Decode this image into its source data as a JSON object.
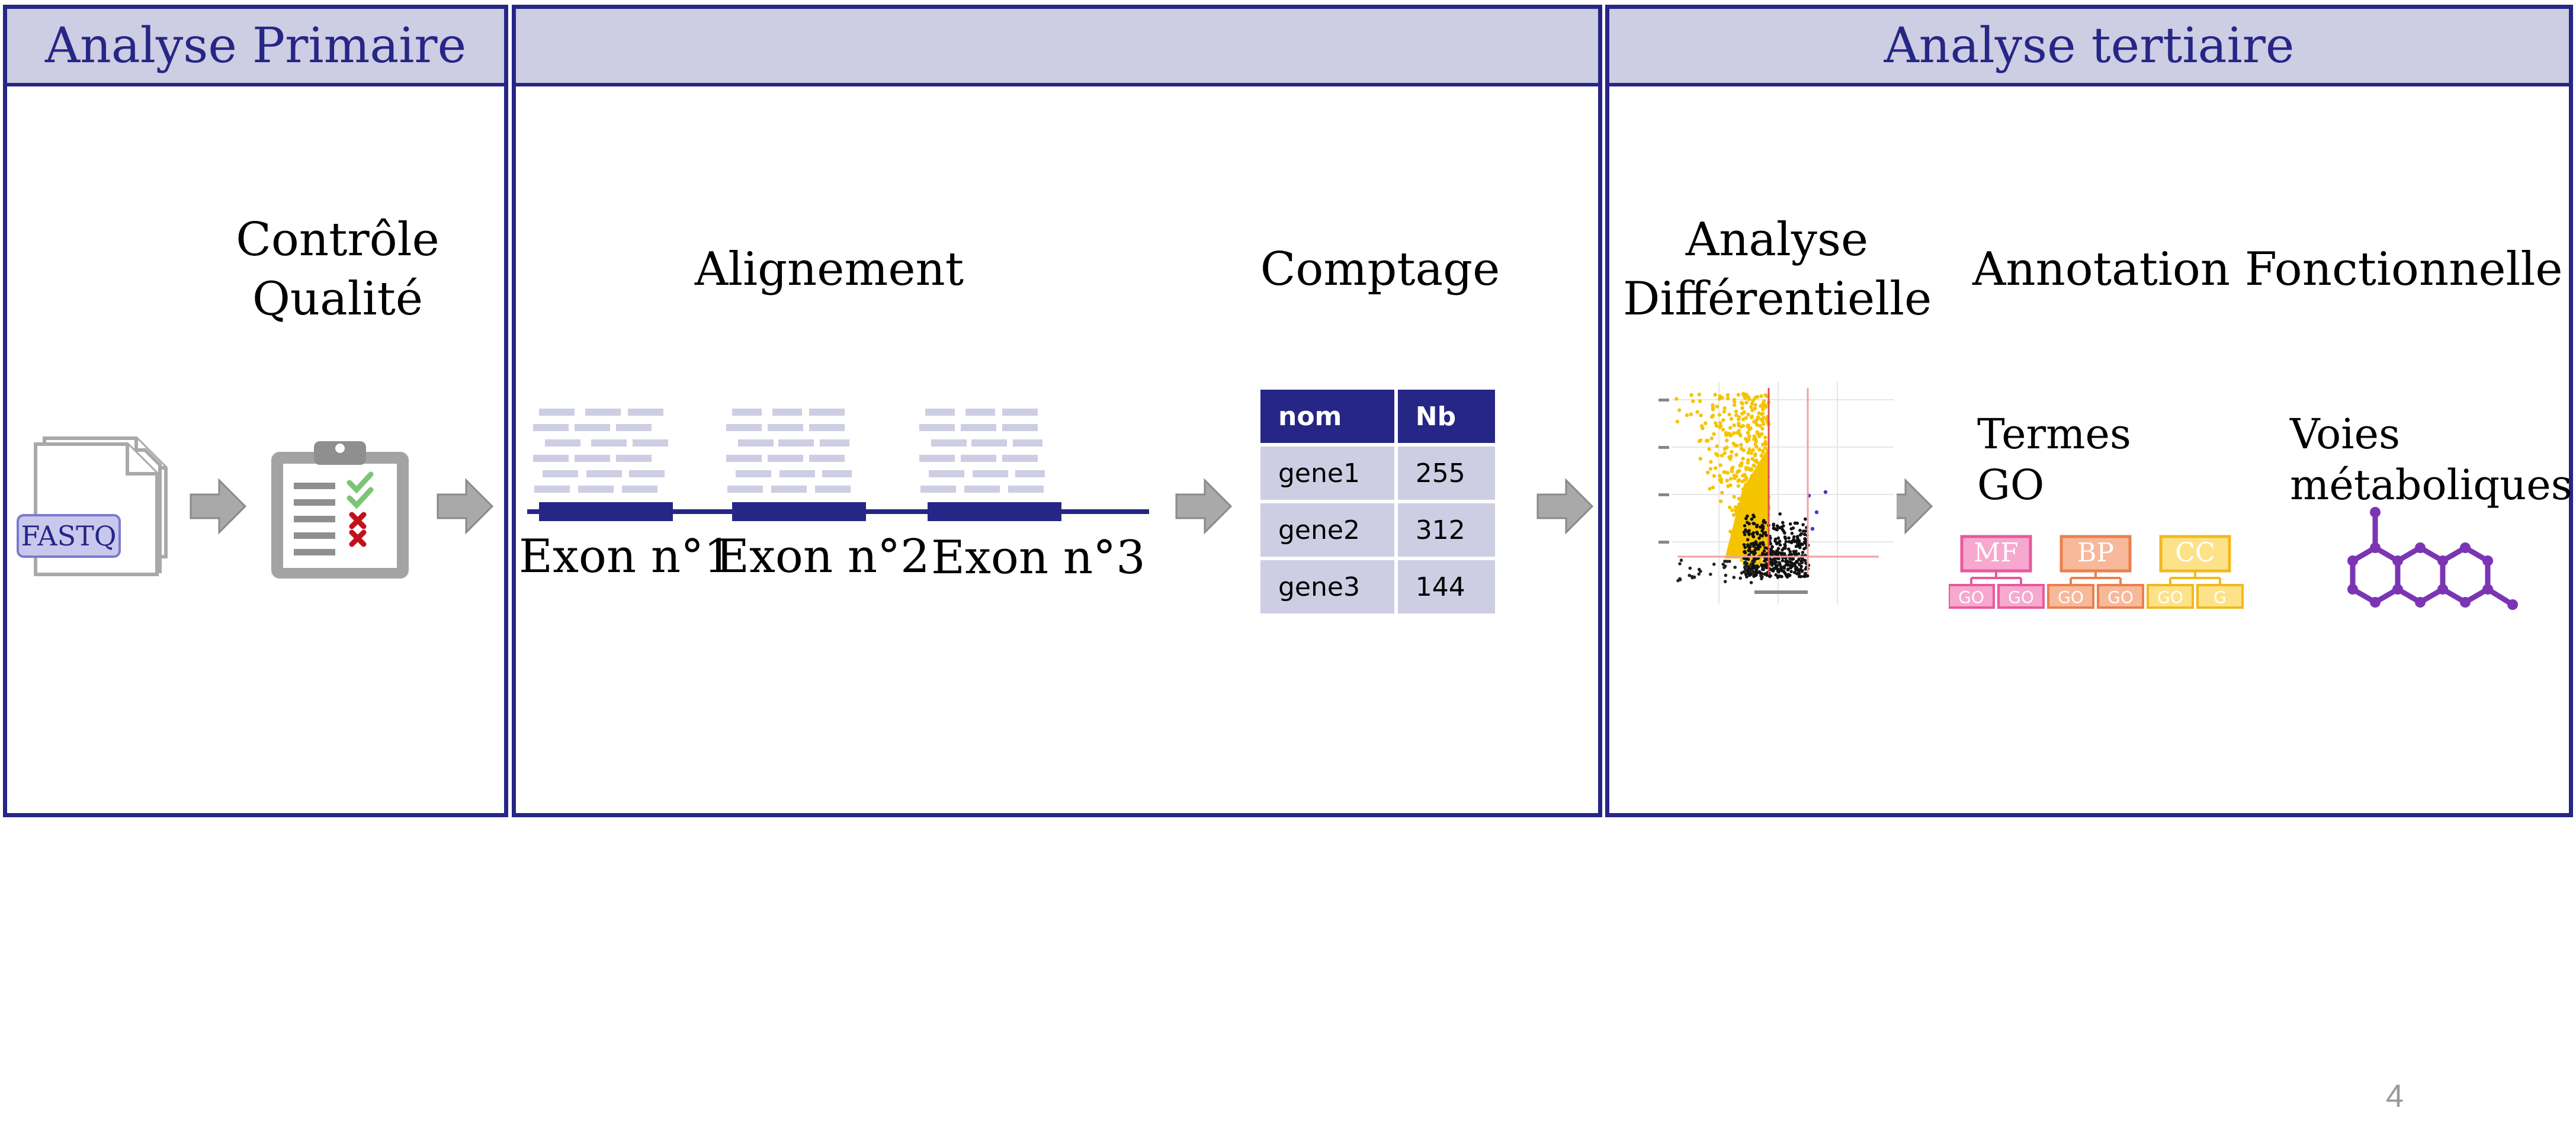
{
  "panels": {
    "primary": {
      "header": "Analyse Primaire"
    },
    "secondary": {
      "header": ""
    },
    "tertiary": {
      "header": "Analyse tertiaire"
    }
  },
  "steps": {
    "quality_control": {
      "line1": "Contrôle",
      "line2": "Qualité"
    },
    "alignment": {
      "title": "Alignement"
    },
    "counting": {
      "title": "Comptage"
    },
    "differential": {
      "line1": "Analyse",
      "line2": "Différentielle"
    },
    "functional": {
      "title": "Annotation Fonctionnelle"
    }
  },
  "fastq": {
    "label": "FASTQ"
  },
  "exons": [
    {
      "label": "Exon n°1"
    },
    {
      "label": "Exon n°2"
    },
    {
      "label": "Exon n°3"
    }
  ],
  "count_table": {
    "headers": [
      "nom",
      "Nb"
    ],
    "rows": [
      [
        "gene1",
        "255"
      ],
      [
        "gene2",
        "312"
      ],
      [
        "gene3",
        "144"
      ]
    ]
  },
  "go": {
    "line1": "Termes",
    "line2": "GO",
    "categories": [
      {
        "label": "MF",
        "sub": [
          "GO",
          "GO"
        ],
        "fill": "#f7a8cf",
        "stroke": "#e8589c"
      },
      {
        "label": "BP",
        "sub": [
          "GO",
          "GO"
        ],
        "fill": "#f8b89a",
        "stroke": "#ec7f4c"
      },
      {
        "label": "CC",
        "sub": [
          "GO",
          "G"
        ],
        "fill": "#fde28a",
        "stroke": "#f2b91c"
      }
    ]
  },
  "pathways": {
    "line1": "Voies",
    "line2": "métaboliques"
  },
  "page": {
    "number": "4"
  },
  "colors": {
    "navy": "#262686",
    "header_bg": "#cdcde3",
    "read": "#cdcde3",
    "arrow": "#a9a9a9",
    "molecule": "#7b35b4"
  }
}
